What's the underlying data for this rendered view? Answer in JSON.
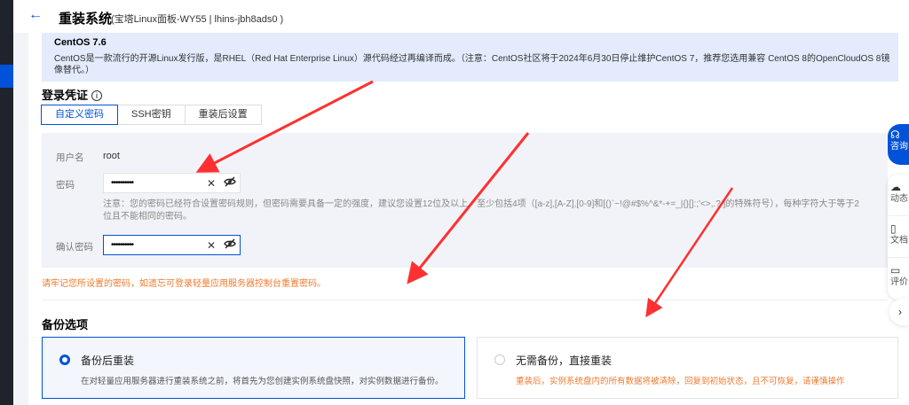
{
  "header": {
    "back_icon": "arrow-left-icon",
    "title": "重装系统",
    "subtitle": "(宝塔Linux面板-WY55 | lhins-jbh8ads0 )"
  },
  "image_info": {
    "name": "CentOS 7.6",
    "description": "CentOS是一款流行的开源Linux发行版，是RHEL（Red Hat Enterprise Linux）源代码经过再编译而成。（注意：CentOS社区将于2024年6月30日停止维护CentOS 7，推荐您选用兼容 CentOS 8的OpenCloudOS 8镜像替代。）"
  },
  "credentials": {
    "title": "登录凭证",
    "info_icon": "i",
    "tabs": [
      {
        "label": "自定义密码",
        "active": true
      },
      {
        "label": "SSH密钥"
      },
      {
        "label": "重装后设置"
      }
    ],
    "username_label": "用户名",
    "username": "root",
    "password_label": "密码",
    "password_value": "••••••••••",
    "password_note": "注意：您的密码已经符合设置密码规则，但密码需要具备一定的强度，建议您设置12位及以上，至少包括4项（[a-z],[A-Z],[0-9]和[()`~!@#$%^&*-+=_|{}[]:;'<>,.?/]的特殊符号），每种字符大于等于2位且不能相同的密码。",
    "confirm_label": "确认密码",
    "confirm_value": "••••••••••",
    "clear_icon": "✕",
    "eye_icon": "eye-off-icon",
    "warning": "请牢记您所设置的密码，如遗忘可登录轻量应用服务器控制台重置密码。"
  },
  "backup": {
    "title": "备份选项",
    "options": [
      {
        "title": "备份后重装",
        "desc": "在对轻量应用服务器进行重装系统之前，将首先为您创建实例系统盘快照，对实例数据进行备份。",
        "selected": true
      },
      {
        "title": "无需备份，直接重装",
        "desc": "重装后，实例系统盘内的所有数据将被清除，回复到初始状态，且不可恢复，请谨慎操作",
        "selected": false
      }
    ]
  },
  "float_bar": {
    "consult": "咨询",
    "items": [
      {
        "label": "动态",
        "icon": "cloud-icon"
      },
      {
        "label": "文档",
        "icon": "book-icon"
      },
      {
        "label": "评价",
        "icon": "feedback-icon"
      }
    ],
    "expand": "›"
  },
  "colors": {
    "primary": "#0052d9",
    "warning": "#ed7b2f",
    "annotation": "#ff3030"
  }
}
